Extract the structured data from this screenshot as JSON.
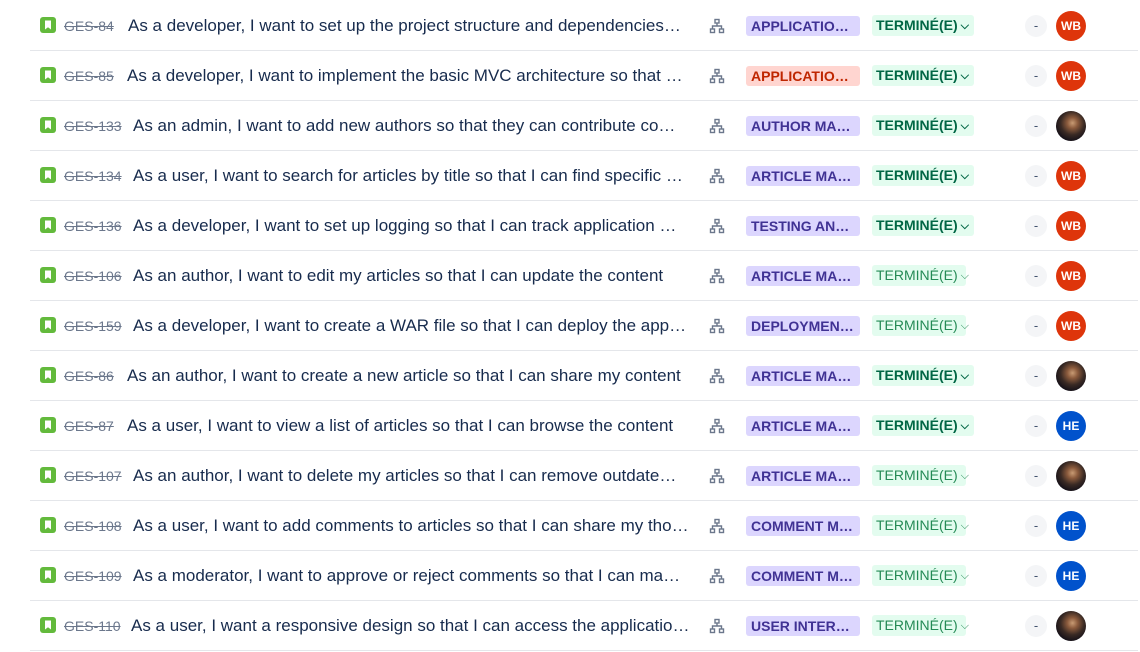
{
  "colors": {
    "story_icon": "#63ba3c",
    "epic_bg": "#dcd6fe",
    "epic_text": "#403294",
    "epic_alt_bg": "#ffd5d0",
    "epic_alt_text": "#bf2600",
    "status_bg": "#e3fcef",
    "status_text": "#006644",
    "avatar_wb": "#de350b",
    "avatar_he": "#0052cc"
  },
  "issues": [
    {
      "key": "GES-84",
      "summary": "As a developer, I want to set up the project structure and dependencies…",
      "epic": "APPLICATION…",
      "status": "TERMINÉ(E)",
      "estimate": "-",
      "assignee": "WB"
    },
    {
      "key": "GES-85",
      "summary": "As a developer, I want to implement the basic MVC architecture so that …",
      "epic": "APPLICATION…",
      "status": "TERMINÉ(E)",
      "estimate": "-",
      "assignee": "WB"
    },
    {
      "key": "GES-133",
      "summary": "As an admin, I want to add new authors so that they can contribute co…",
      "epic": "AUTHOR MA…",
      "status": "TERMINÉ(E)",
      "estimate": "-",
      "assignee": ""
    },
    {
      "key": "GES-134",
      "summary": "As a user, I want to search for articles by title so that I can find specific …",
      "epic": "ARTICLE MAN…",
      "status": "TERMINÉ(E)",
      "estimate": "-",
      "assignee": "WB"
    },
    {
      "key": "GES-136",
      "summary": "As a developer, I want to set up logging so that I can track application …",
      "epic": "TESTING AND…",
      "status": "TERMINÉ(E)",
      "estimate": "-",
      "assignee": "WB"
    },
    {
      "key": "GES-106",
      "summary": "As an author, I want to edit my articles so that I can update the content",
      "epic": "ARTICLE MAN…",
      "status": "TERMINÉ(E)",
      "estimate": "-",
      "assignee": "WB"
    },
    {
      "key": "GES-159",
      "summary": "As a developer, I want to create a WAR file so that I can deploy the app…",
      "epic": "DEPLOYMENT…",
      "status": "TERMINÉ(E)",
      "estimate": "-",
      "assignee": "WB"
    },
    {
      "key": "GES-86",
      "summary": "As an author, I want to create a new article so that I can share my content",
      "epic": "ARTICLE MAN…",
      "status": "TERMINÉ(E)",
      "estimate": "-",
      "assignee": ""
    },
    {
      "key": "GES-87",
      "summary": "As a user, I want to view a list of articles so that I can browse the content",
      "epic": "ARTICLE MAN…",
      "status": "TERMINÉ(E)",
      "estimate": "-",
      "assignee": "HE"
    },
    {
      "key": "GES-107",
      "summary": "As an author, I want to delete my articles so that I can remove outdate…",
      "epic": "ARTICLE MAN…",
      "status": "TERMINÉ(E)",
      "estimate": "-",
      "assignee": ""
    },
    {
      "key": "GES-108",
      "summary": "As a user, I want to add comments to articles so that I can share my tho…",
      "epic": "COMMENT M…",
      "status": "TERMINÉ(E)",
      "estimate": "-",
      "assignee": "HE"
    },
    {
      "key": "GES-109",
      "summary": "As a moderator, I want to approve or reject comments so that I can ma…",
      "epic": "COMMENT M…",
      "status": "TERMINÉ(E)",
      "estimate": "-",
      "assignee": "HE"
    },
    {
      "key": "GES-110",
      "summary": "As a user, I want a responsive design so that I can access the applicatio…",
      "epic": "USER INTERF…",
      "status": "TERMINÉ(E)",
      "estimate": "-",
      "assignee": ""
    }
  ]
}
